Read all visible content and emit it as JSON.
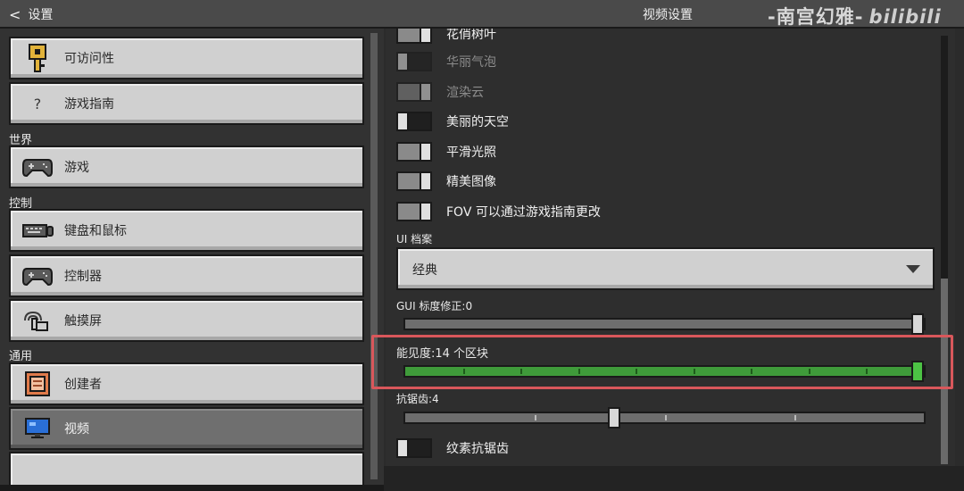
{
  "header": {
    "back_label": "设置",
    "title": "视频设置",
    "watermark_text": "-南宫幻雅-",
    "watermark_logo": "bilibili"
  },
  "sidebar": {
    "items_top": [
      {
        "label": "可访问性",
        "icon": "key-icon"
      },
      {
        "label": "游戏指南",
        "icon": "question-icon",
        "icon_glyph": "?"
      }
    ],
    "sections": [
      {
        "label": "世界",
        "items": [
          {
            "label": "游戏",
            "icon": "gamepad-icon"
          }
        ]
      },
      {
        "label": "控制",
        "items": [
          {
            "label": "键盘和鼠标",
            "icon": "keyboard-icon"
          },
          {
            "label": "控制器",
            "icon": "controller-icon"
          },
          {
            "label": "触摸屏",
            "icon": "touch-icon"
          }
        ]
      },
      {
        "label": "通用",
        "items": [
          {
            "label": "创建者",
            "icon": "creator-icon"
          },
          {
            "label": "视频",
            "icon": "monitor-icon",
            "selected": true
          }
        ]
      }
    ]
  },
  "video_settings": {
    "toggles": [
      {
        "label": "花俏树叶",
        "state": "on",
        "enabled": true
      },
      {
        "label": "华丽气泡",
        "state": "off",
        "enabled": false
      },
      {
        "label": "渲染云",
        "state": "on",
        "enabled": false
      },
      {
        "label": "美丽的天空",
        "state": "off",
        "enabled": true
      },
      {
        "label": "平滑光照",
        "state": "on",
        "enabled": true
      },
      {
        "label": "精美图像",
        "state": "on",
        "enabled": true
      },
      {
        "label": "FOV 可以通过游戏指南更改",
        "state": "on",
        "enabled": true
      }
    ],
    "ui_profile": {
      "label": "UI 档案",
      "value": "经典"
    },
    "gui_scale": {
      "label": "GUI 标度修正:0",
      "level": 1.0
    },
    "render_distance": {
      "label": "能见度:14 个区块",
      "level": 1.0,
      "ticks": 9,
      "color": "#3f9b3a"
    },
    "antialiasing": {
      "label": "抗锯齿:4",
      "level": 0.4,
      "ticks": 4
    },
    "texture_aa": {
      "label": "纹素抗锯齿",
      "state": "off"
    }
  },
  "colors": {
    "highlight": "#d9575b",
    "slider_active": "#3f9b3a"
  }
}
